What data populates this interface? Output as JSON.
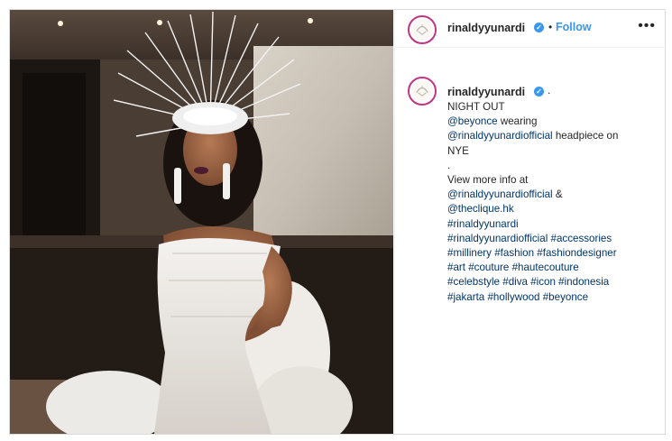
{
  "header": {
    "username": "rinaldyyunardi",
    "separator": "•",
    "follow_label": "Follow",
    "more_label": "•••"
  },
  "caption": {
    "username": "rinaldyyunardi",
    "separator": ".",
    "lines": [
      [
        {
          "text": "NIGHT OUT",
          "link": false
        }
      ],
      [
        {
          "text": "@beyonce",
          "link": true
        },
        {
          "text": " wearing",
          "link": false
        }
      ],
      [
        {
          "text": "@rinaldyyunardiofficial",
          "link": true
        },
        {
          "text": " headpiece on",
          "link": false
        }
      ],
      [
        {
          "text": "NYE",
          "link": false
        }
      ],
      [
        {
          "text": ".",
          "link": false
        }
      ],
      [
        {
          "text": "View more info at",
          "link": false
        }
      ],
      [
        {
          "text": "@rinaldyyunardiofficial",
          "link": true
        },
        {
          "text": " &",
          "link": false
        }
      ],
      [
        {
          "text": "@theclique.hk",
          "link": true
        }
      ],
      [
        {
          "text": "#rinaldyyunardi",
          "link": true
        }
      ],
      [
        {
          "text": "#rinaldyyunardiofficial",
          "link": true
        },
        {
          "text": " ",
          "link": false
        },
        {
          "text": "#accessories",
          "link": true
        }
      ],
      [
        {
          "text": "#millinery",
          "link": true
        },
        {
          "text": " ",
          "link": false
        },
        {
          "text": "#fashion",
          "link": true
        },
        {
          "text": " ",
          "link": false
        },
        {
          "text": "#fashiondesigner",
          "link": true
        }
      ],
      [
        {
          "text": "#art",
          "link": true
        },
        {
          "text": " ",
          "link": false
        },
        {
          "text": "#couture",
          "link": true
        },
        {
          "text": " ",
          "link": false
        },
        {
          "text": "#hautecouture",
          "link": true
        }
      ],
      [
        {
          "text": "#celebstyle",
          "link": true
        },
        {
          "text": " ",
          "link": false
        },
        {
          "text": "#diva",
          "link": true
        },
        {
          "text": " ",
          "link": false
        },
        {
          "text": "#icon",
          "link": true
        },
        {
          "text": " ",
          "link": false
        },
        {
          "text": "#indonesia",
          "link": true
        }
      ],
      [
        {
          "text": "#jakarta",
          "link": true
        },
        {
          "text": " ",
          "link": false
        },
        {
          "text": "#hollywood",
          "link": true
        },
        {
          "text": " ",
          "link": false
        },
        {
          "text": "#beyonce",
          "link": true
        }
      ]
    ]
  },
  "colors": {
    "link": "#003569",
    "follow": "#3897f0",
    "verified": "#3897f0",
    "text": "#262626",
    "border": "#dbdbdb"
  },
  "icons": {
    "verified": "verified-badge-icon",
    "more": "more-options-icon"
  }
}
